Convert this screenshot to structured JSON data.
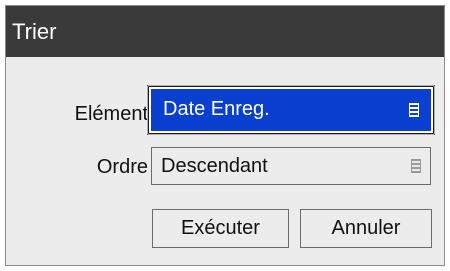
{
  "dialog": {
    "title": "Trier"
  },
  "fields": {
    "element": {
      "label": "Elément",
      "value": "Date Enreg."
    },
    "ordre": {
      "label": "Ordre",
      "value": "Descendant"
    }
  },
  "buttons": {
    "execute": "Exécuter",
    "cancel": "Annuler"
  },
  "colors": {
    "titlebar": "#3a3a3a",
    "selected_field": "#0a3fd0",
    "dialog_bg": "#ececec"
  },
  "icons": {
    "dropdown": "list-menu-icon"
  }
}
